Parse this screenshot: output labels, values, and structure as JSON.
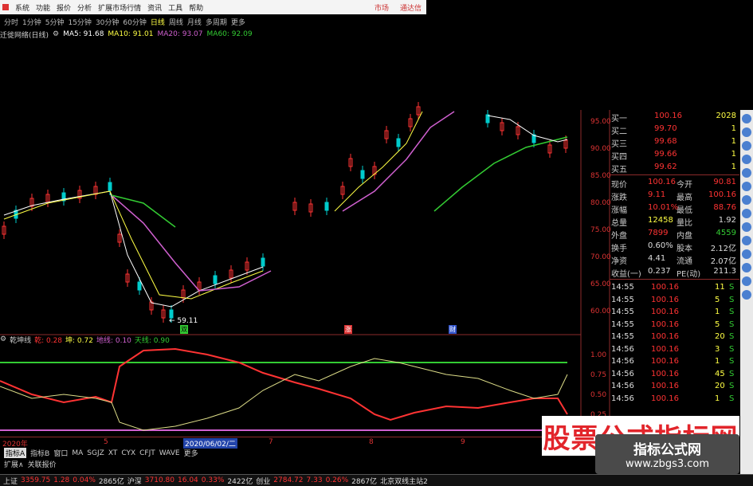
{
  "menu": {
    "items": [
      "系统",
      "功能",
      "报价",
      "分析",
      "扩展市场行情",
      "资讯",
      "工具",
      "帮助"
    ],
    "market": "市场",
    "broker": "通达信"
  },
  "periods": {
    "items": [
      "分时",
      "1分钟",
      "5分钟",
      "15分钟",
      "30分钟",
      "60分钟",
      "日线",
      "周线",
      "月线",
      "多周期",
      "更多"
    ],
    "active": 6
  },
  "stock": {
    "name": "迁徙网络(日线)",
    "ma": [
      {
        "label": "MA5: 91.68",
        "color": "#ffffff"
      },
      {
        "label": "MA10: 91.01",
        "color": "#ffff44"
      },
      {
        "label": "MA20: 93.07",
        "color": "#d060d0"
      },
      {
        "label": "MA60: 92.09",
        "color": "#33cc33"
      }
    ]
  },
  "axis_main": [
    "95.00",
    "90.00",
    "85.00",
    "80.00",
    "75.00",
    "70.00",
    "65.00",
    "60.00"
  ],
  "annot": {
    "low": "← 59.11",
    "mark1": "双",
    "mark2": "涨",
    "mark3": "财"
  },
  "quote": {
    "buy": [
      {
        "label": "买一",
        "price": "100.16",
        "vol": "2028"
      },
      {
        "label": "买二",
        "price": "99.70",
        "vol": "1"
      },
      {
        "label": "买三",
        "price": "99.68",
        "vol": "1"
      },
      {
        "label": "买四",
        "price": "99.66",
        "vol": "1"
      },
      {
        "label": "买五",
        "price": "99.62",
        "vol": "1"
      }
    ],
    "stats": [
      {
        "l1": "现价",
        "v1": "100.16",
        "l2": "今开",
        "v2": "90.81"
      },
      {
        "l1": "涨跌",
        "v1": "9.11",
        "l2": "最高",
        "v2": "100.16"
      },
      {
        "l1": "涨幅",
        "v1": "10.01%",
        "l2": "最低",
        "v2": "88.76"
      },
      {
        "l1": "总量",
        "v1": "12458",
        "l2": "量比",
        "v2": "1.92"
      },
      {
        "l1": "外盘",
        "v1": "7899",
        "l2": "内盘",
        "v2": "4559"
      },
      {
        "l1": "换手",
        "v1": "0.60%",
        "l2": "股本",
        "v2": "2.12亿"
      },
      {
        "l1": "净资",
        "v1": "4.41",
        "l2": "流通",
        "v2": "2.07亿"
      },
      {
        "l1": "收益(一)",
        "v1": "0.237",
        "l2": "PE(动)",
        "v2": "211.3"
      }
    ],
    "ticks": [
      {
        "t": "14:55",
        "p": "100.16",
        "v": "11",
        "s": "S"
      },
      {
        "t": "14:55",
        "p": "100.16",
        "v": "5",
        "s": "S"
      },
      {
        "t": "14:55",
        "p": "100.16",
        "v": "1",
        "s": "S"
      },
      {
        "t": "14:55",
        "p": "100.16",
        "v": "5",
        "s": "S"
      },
      {
        "t": "14:55",
        "p": "100.16",
        "v": "20",
        "s": "S"
      },
      {
        "t": "14:56",
        "p": "100.16",
        "v": "3",
        "s": "S"
      },
      {
        "t": "14:56",
        "p": "100.16",
        "v": "1",
        "s": "S"
      },
      {
        "t": "14:56",
        "p": "100.16",
        "v": "45",
        "s": "S"
      },
      {
        "t": "14:56",
        "p": "100.16",
        "v": "20",
        "s": "S"
      },
      {
        "t": "14:56",
        "p": "100.16",
        "v": "1",
        "s": "S"
      }
    ]
  },
  "indicator": {
    "name": "乾坤线",
    "items": [
      {
        "label": "乾: 0.28",
        "color": "#ff3333"
      },
      {
        "label": "坤: 0.72",
        "color": "#ffff44"
      },
      {
        "label": "地线: 0.10",
        "color": "#d060d0"
      },
      {
        "label": "天线: 0.90",
        "color": "#33cc33"
      }
    ]
  },
  "axis_sub": [
    "1.00",
    "0.75",
    "0.50",
    "0.25"
  ],
  "xaxis": {
    "year": "2020年",
    "labels": [
      "5",
      "7",
      "8",
      "9"
    ],
    "cursor": "2020/06/02/二"
  },
  "tabs": {
    "items": [
      "指标A",
      "指标B",
      "窗口",
      "MA",
      "SGJZ",
      "XT",
      "CYX",
      "CFJT",
      "WAVE",
      "更多"
    ],
    "active": 0,
    "row2": [
      "扩展∧",
      "关联报价"
    ]
  },
  "status": [
    {
      "t": "上证",
      "c": "#ddd"
    },
    {
      "t": "3359.75",
      "c": "#ff3333"
    },
    {
      "t": "1.28",
      "c": "#ff3333"
    },
    {
      "t": "0.04%",
      "c": "#ff3333"
    },
    {
      "t": "2865亿",
      "c": "#ddd"
    },
    {
      "t": "沪深",
      "c": "#ddd"
    },
    {
      "t": "3710.80",
      "c": "#ff3333"
    },
    {
      "t": "16.04",
      "c": "#ff3333"
    },
    {
      "t": "0.33%",
      "c": "#ff3333"
    },
    {
      "t": "2422亿",
      "c": "#ddd"
    },
    {
      "t": "创业",
      "c": "#ddd"
    },
    {
      "t": "2784.72",
      "c": "#ff3333"
    },
    {
      "t": "7.33",
      "c": "#ff3333"
    },
    {
      "t": "0.26%",
      "c": "#ff3333"
    },
    {
      "t": "2867亿",
      "c": "#ddd"
    },
    {
      "t": "北京双线主站2",
      "c": "#ddd"
    }
  ],
  "watermark": {
    "big": "股票公式指标网",
    "title": "指标公式网",
    "url": "www.zbgs3.com"
  },
  "colors": {
    "up": "#ff3333",
    "down": "#00cccc",
    "grid": "#8b2a2a",
    "ma5": "#ffffff",
    "ma10": "#ffff44",
    "ma20": "#d060d0",
    "ma60": "#33cc33"
  }
}
